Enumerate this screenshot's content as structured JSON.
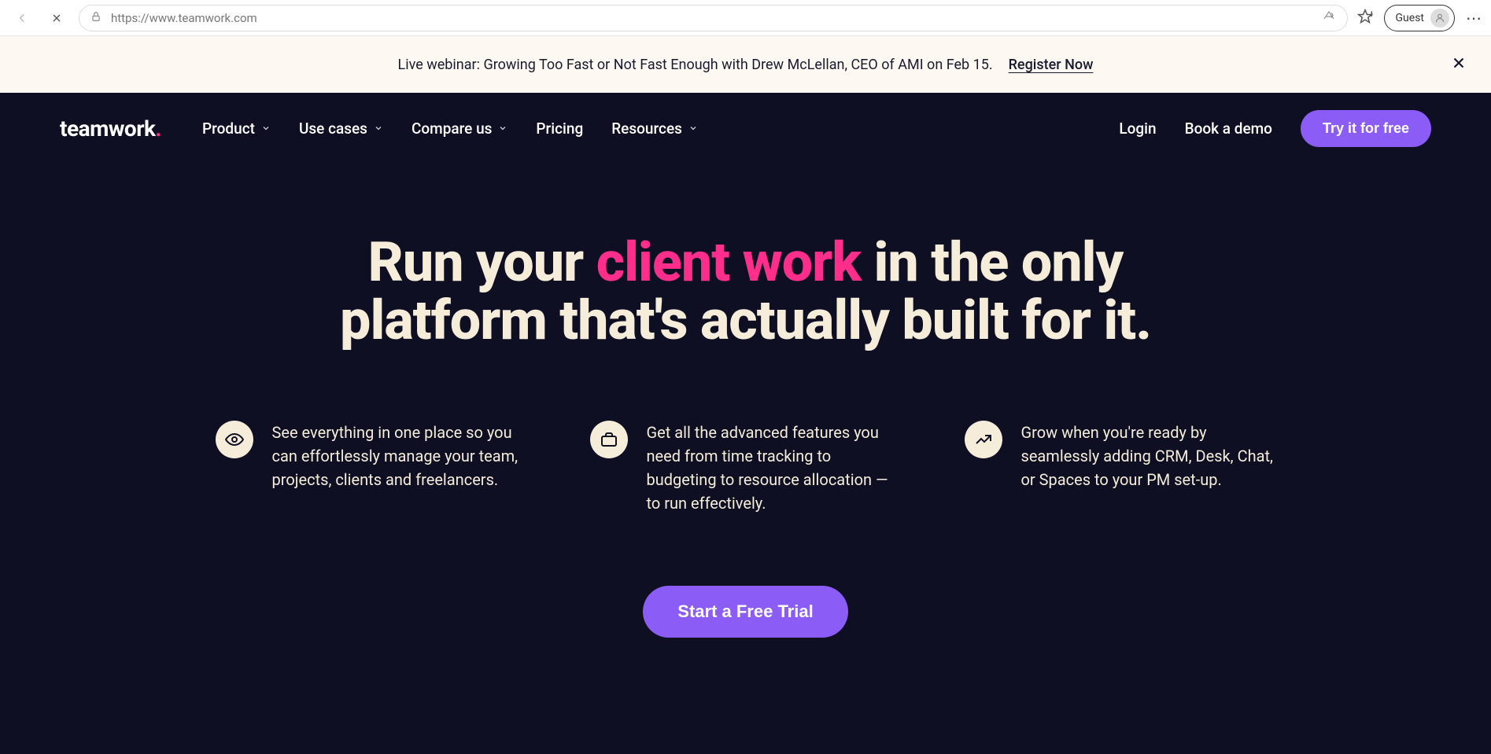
{
  "browser": {
    "url": "https://www.teamwork.com",
    "guest_label": "Guest"
  },
  "banner": {
    "text": "Live webinar: Growing Too Fast or Not Fast Enough with Drew McLellan, CEO of AMI on Feb 15.",
    "link": "Register Now"
  },
  "nav": {
    "logo": "teamwork",
    "items": [
      {
        "label": "Product",
        "dropdown": true
      },
      {
        "label": "Use cases",
        "dropdown": true
      },
      {
        "label": "Compare us",
        "dropdown": true
      },
      {
        "label": "Pricing",
        "dropdown": false
      },
      {
        "label": "Resources",
        "dropdown": true
      }
    ],
    "login": "Login",
    "demo": "Book a demo",
    "cta": "Try it for free"
  },
  "headline": {
    "pre": "Run your ",
    "highlight": "client work",
    "post": " in the only platform that's actually built for it."
  },
  "features": [
    {
      "text": "See everything in one place so you can effortlessly manage your team, projects, clients and freelancers."
    },
    {
      "text": "Get all the advanced features you need from time tracking to budgeting to resource allocation — to run effectively."
    },
    {
      "text": "Grow when you're ready by seamlessly adding CRM, Desk, Chat, or Spaces to your PM set-up."
    }
  ],
  "trial_cta": "Start a Free Trial"
}
